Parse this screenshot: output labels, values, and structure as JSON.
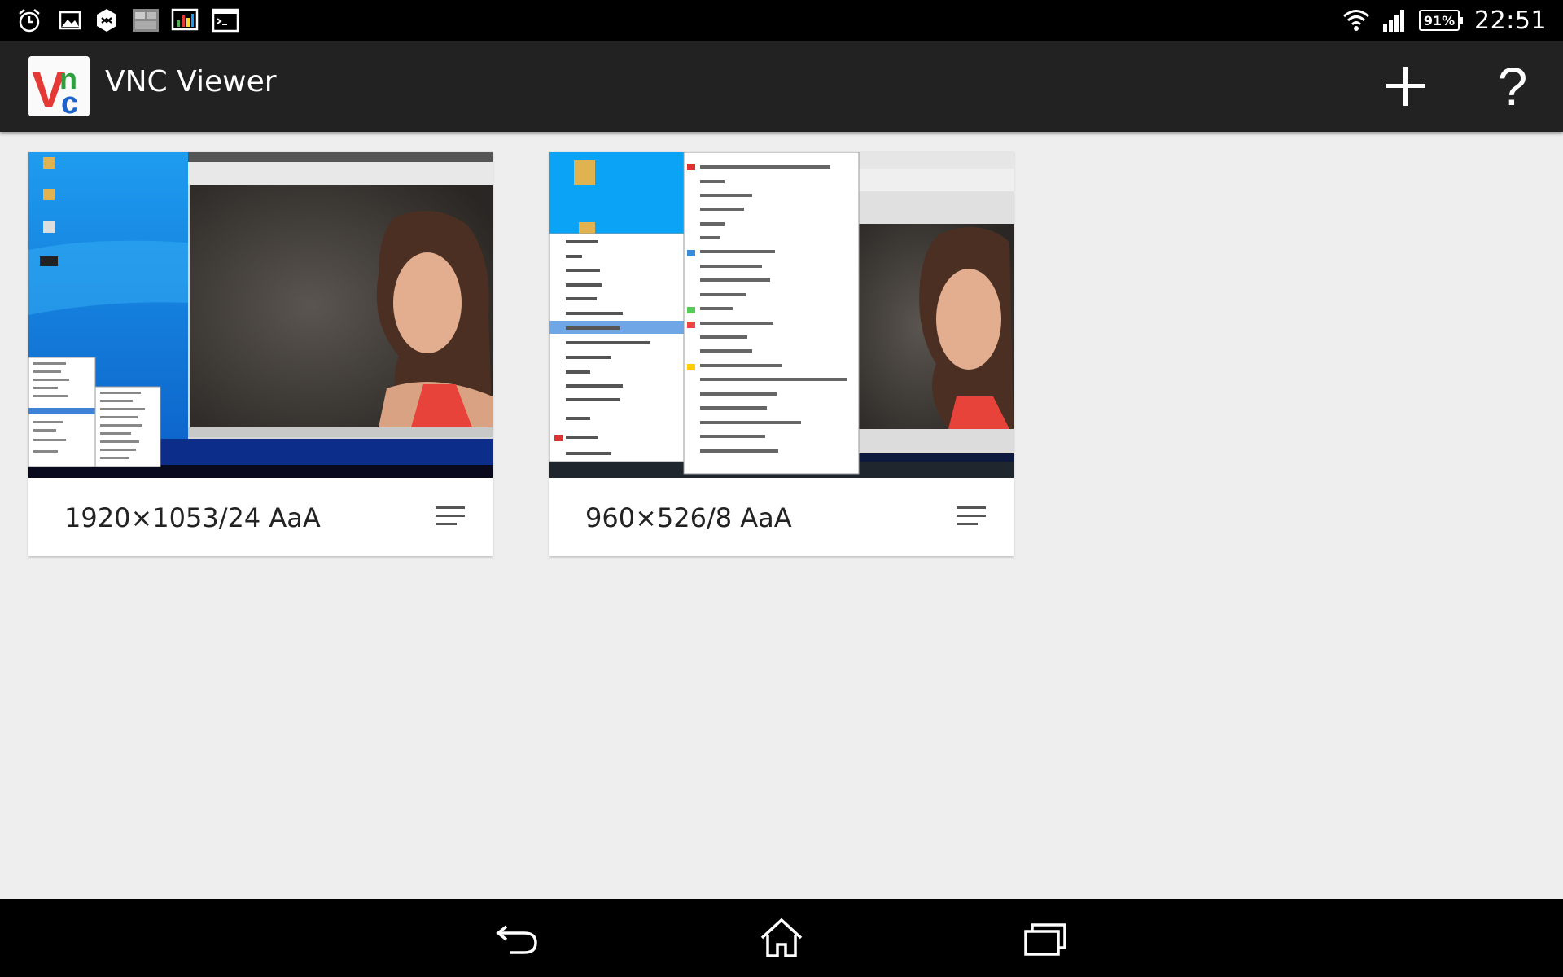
{
  "status_bar": {
    "time": "22:51",
    "battery_level": "91%",
    "left_icons": [
      "alarm-icon",
      "gallery-icon",
      "sync-icon",
      "vnc-notification-icon",
      "chart-monitor-icon",
      "terminal-icon"
    ],
    "right_icons": [
      "wifi-icon",
      "cell-signal-icon",
      "battery-icon"
    ]
  },
  "action_bar": {
    "title": "VNC Viewer",
    "logo_text": "Vnc",
    "actions": [
      "add-icon",
      "help-icon"
    ],
    "help_label": "?"
  },
  "connections": [
    {
      "label": "1920×1053/24 AaA"
    },
    {
      "label": "960×526/8 AaA"
    }
  ],
  "nav_bar": {
    "buttons": [
      "back-icon",
      "home-icon",
      "recent-apps-icon"
    ]
  },
  "colors": {
    "status_bar_bg": "#000000",
    "action_bar_bg": "#222222",
    "content_bg": "#eeeeee",
    "card_bg": "#ffffff",
    "desktop_blue": "#1a8fe3"
  }
}
